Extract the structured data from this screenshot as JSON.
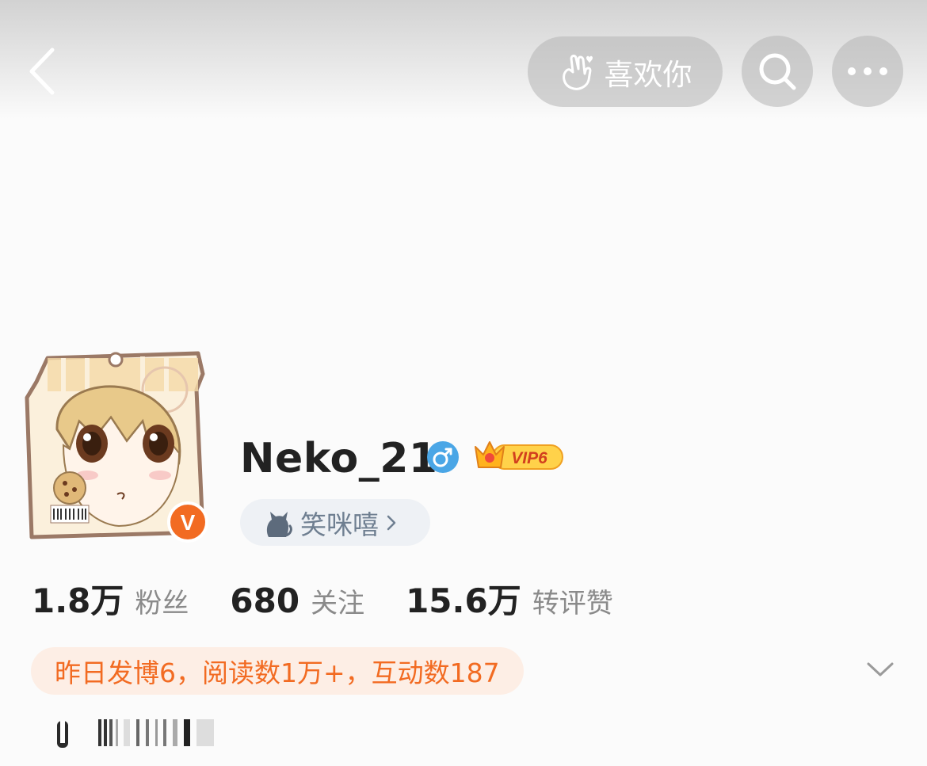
{
  "header": {
    "back_icon": "chevron-left-icon",
    "like_label": "喜欢你",
    "like_icon": "heart-hand-icon",
    "search_icon": "search-icon",
    "more_icon": "more-dots-icon"
  },
  "profile": {
    "avatar_badge": "V",
    "avatar_badge_color": "#f26b22",
    "username": "Neko_21",
    "gender_icon": "male-icon",
    "gender_color": "#4aa6e6",
    "vip_label": "VIP6",
    "fan_group_label": "笑咪嘻",
    "fan_group_chevron": "›"
  },
  "stats": [
    {
      "num": "1.8万",
      "label": "粉丝"
    },
    {
      "num": "680",
      "label": "关注"
    },
    {
      "num": "15.6万",
      "label": "转评赞"
    }
  ],
  "activity": {
    "text": "昨日发博6，阅读数1万+，互动数187",
    "color": "#f26b22"
  },
  "expand_icon": "chevron-down-icon"
}
